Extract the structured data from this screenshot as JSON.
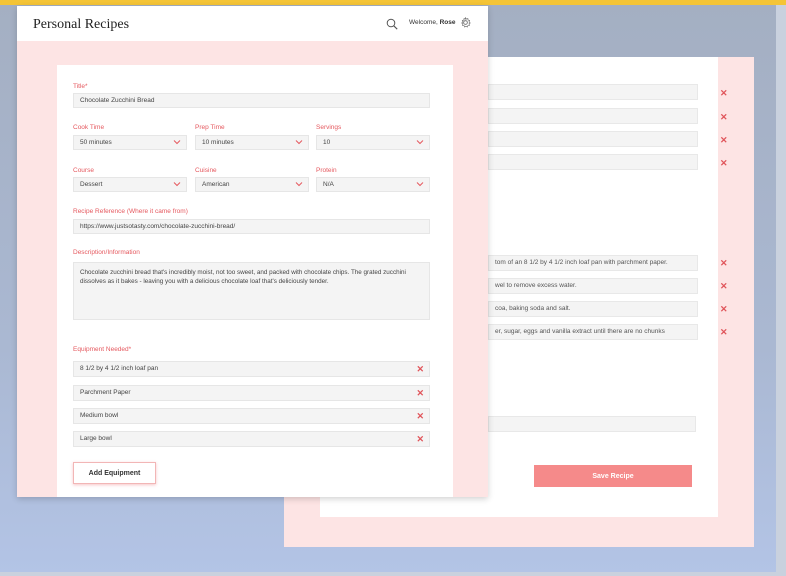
{
  "header": {
    "app_title": "Personal Recipes",
    "welcome_prefix": "Welcome,",
    "user_name": "Rose"
  },
  "form": {
    "title_label": "Title*",
    "title_value": "Chocolate Zucchini Bread",
    "cook_time_label": "Cook Time",
    "cook_time_value": "50 minutes",
    "prep_time_label": "Prep Time",
    "prep_time_value": "10 minutes",
    "servings_label": "Servings",
    "servings_value": "10",
    "course_label": "Course",
    "course_value": "Dessert",
    "cuisine_label": "Cuisine",
    "cuisine_value": "American",
    "protein_label": "Protein",
    "protein_value": "N/A",
    "reference_label": "Recipe Reference (Where it came from)",
    "reference_value": "https://www.justsotasty.com/chocolate-zucchini-bread/",
    "description_label": "Description/Information",
    "description_value": "Chocolate zucchini bread that's incredibly moist, not too sweet, and packed with chocolate chips. The grated zucchini dissolves as it bakes - leaving you with a delicious chocolate loaf that's deliciously tender.",
    "equipment_label": "Equipment Needed*",
    "equipment": [
      "8 1/2 by 4 1/2 inch loaf pan",
      "Parchment Paper",
      "Medium bowl",
      "Large bowl"
    ],
    "add_equipment_label": "Add Equipment",
    "remove_symbol": "✕"
  },
  "back_window": {
    "steps": [
      "tom of an 8 1/2 by 4 1/2 inch loaf pan with parchment paper.",
      "wel to remove excess water.",
      "coa, baking soda and salt.",
      "er, sugar, eggs and vanilla extract until there are no chunks"
    ],
    "save_label": "Save Recipe"
  },
  "colors": {
    "accent": "#e5595f",
    "save_button": "#f58a8a",
    "panel_bg": "#fde4e4"
  }
}
